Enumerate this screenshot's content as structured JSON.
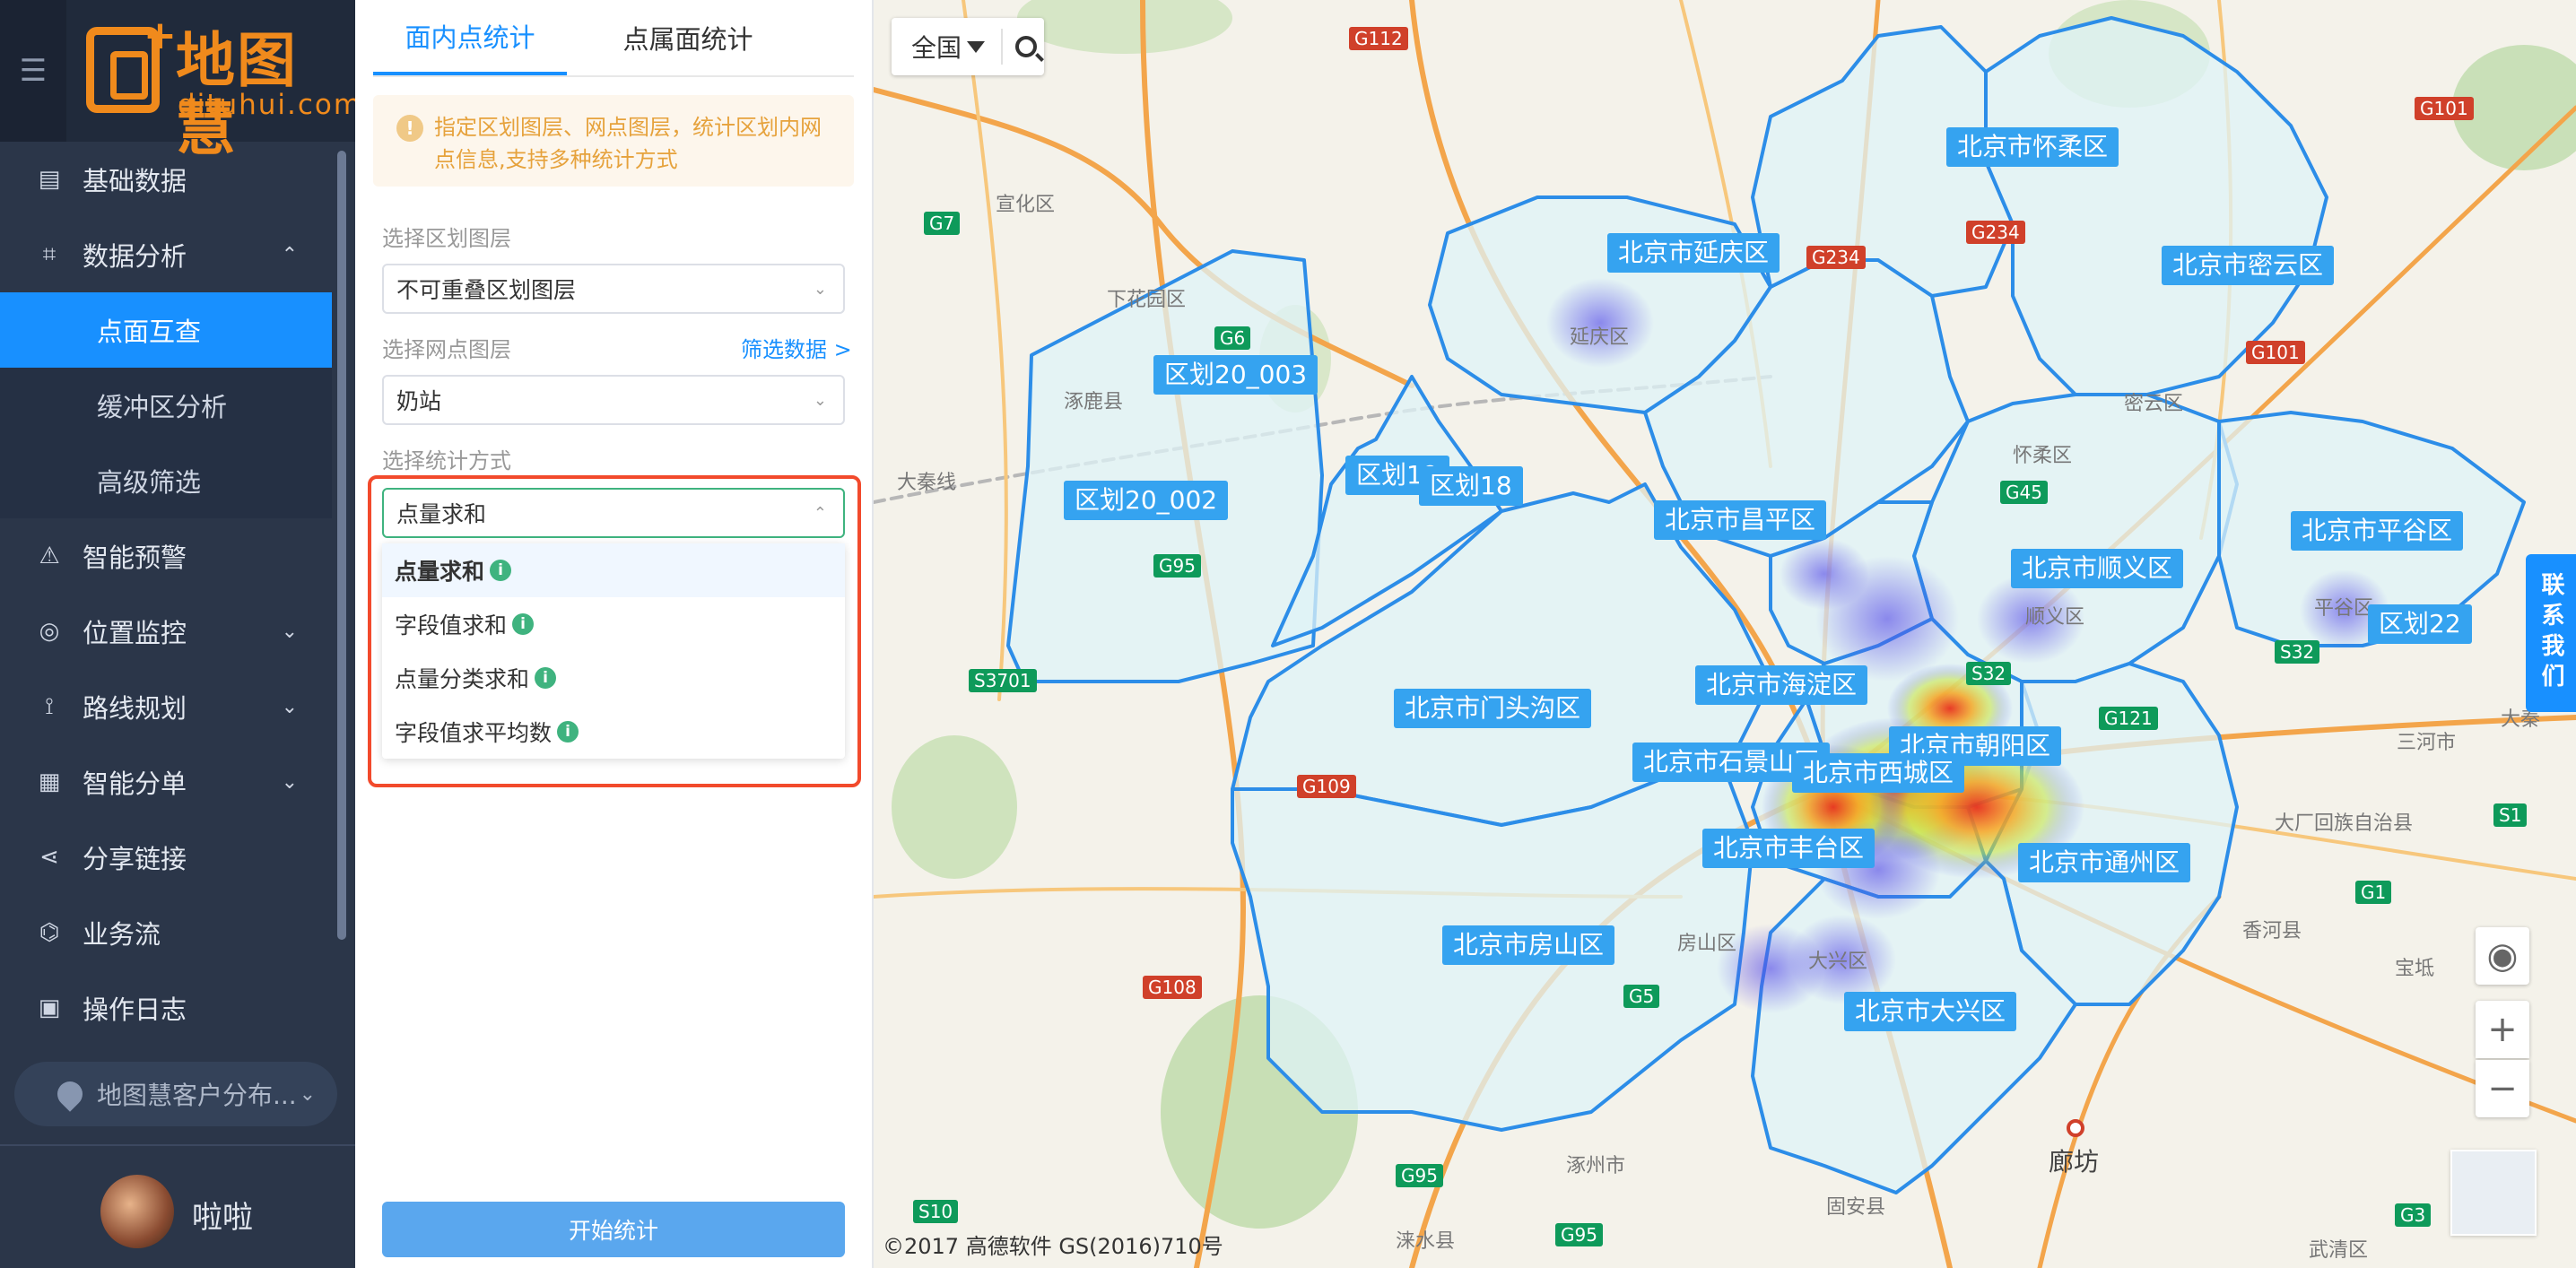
{
  "sidebar": {
    "collapse_icon": "menu-fold-icon",
    "brand_name": "地图慧",
    "brand_domain": "dituhui.com",
    "items": [
      {
        "label": "基础数据",
        "icon": "list-icon"
      },
      {
        "label": "数据分析",
        "icon": "analysis-icon",
        "expanded": true,
        "chevron": "chevron-up-icon"
      },
      {
        "label": "智能预警",
        "icon": "alert-icon"
      },
      {
        "label": "位置监控",
        "icon": "location-icon",
        "chevron": "chevron-down-icon"
      },
      {
        "label": "路线规划",
        "icon": "route-icon",
        "chevron": "chevron-down-icon"
      },
      {
        "label": "智能分单",
        "icon": "dispatch-icon",
        "chevron": "chevron-down-icon"
      },
      {
        "label": "分享链接",
        "icon": "share-icon"
      },
      {
        "label": "业务流",
        "icon": "workflow-icon"
      },
      {
        "label": "操作日志",
        "icon": "log-icon"
      }
    ],
    "subitems": [
      {
        "label": "点面互查",
        "active": true
      },
      {
        "label": "缓冲区分析",
        "active": false
      },
      {
        "label": "高级筛选",
        "active": false
      }
    ],
    "client_map": "地图慧客户分布...",
    "user_name": "啦啦"
  },
  "panel": {
    "tabs": [
      "面内点统计",
      "点属面统计"
    ],
    "active_tab": 0,
    "tip": "指定区划图层、网点图层，统计区划内网点信息,支持多种统计方式",
    "region_layer_label": "选择区划图层",
    "region_layer_value": "不可重叠区划图层",
    "point_layer_label": "选择网点图层",
    "filter_link": "筛选数据 >",
    "point_layer_value": "奶站",
    "stat_method_label": "选择统计方式",
    "stat_method_value": "点量求和",
    "stat_options": [
      "点量求和",
      "字段值求和",
      "点量分类求和",
      "字段值求平均数"
    ],
    "start_button": "开始统计",
    "colors": {
      "accent": "#1890ff",
      "highlight_border": "#f24a2c",
      "info": "#3fb37f"
    }
  },
  "map": {
    "region_selector": "全国",
    "search_icon": "search-icon",
    "district_labels": [
      "北京市怀柔区",
      "北京市延庆区",
      "北京市密云区",
      "区划20_003",
      "区划20_002",
      "区划19",
      "区划18",
      "北京市昌平区",
      "北京市平谷区",
      "北京市顺义区",
      "区划22",
      "北京市海淀区",
      "北京市门头沟区",
      "北京市朝阳区",
      "北京市石景山区",
      "北京市西城区",
      "北京市丰台区",
      "北京市通州区",
      "北京市房山区",
      "北京市大兴区"
    ],
    "places": [
      "宣化区",
      "下花园区",
      "涿鹿县",
      "大秦线",
      "延庆区",
      "怀柔区",
      "密云区",
      "顺义区",
      "平谷区",
      "房山区",
      "大兴区",
      "三河市",
      "大厂回族自治县",
      "香河县",
      "廊坊",
      "涿州市",
      "固安县",
      "涞水县",
      "宝坻",
      "大秦",
      "武清区"
    ],
    "road_shields": [
      "G112",
      "G7",
      "G6",
      "G95",
      "S3701",
      "G109",
      "G108",
      "G234",
      "G234",
      "G101",
      "G101",
      "G45",
      "S32",
      "G121",
      "S1",
      "G1",
      "S10",
      "G95",
      "G95",
      "G5",
      "G3",
      "S32"
    ],
    "contact_tab": "联系我们",
    "copyright": "©2017 高德软件 GS(2016)710号",
    "controls": [
      "eye-icon",
      "zoom-in-icon",
      "zoom-out-icon"
    ]
  }
}
